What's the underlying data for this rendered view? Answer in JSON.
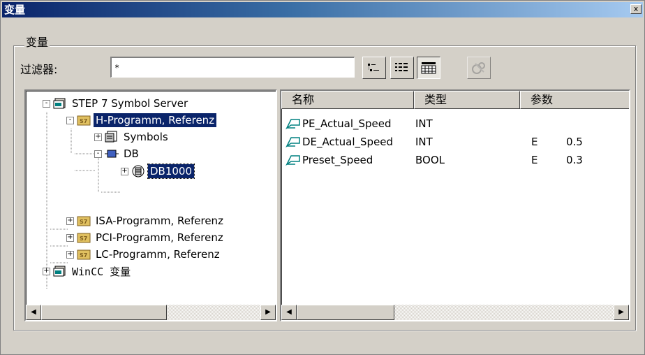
{
  "window": {
    "title": "变量",
    "close_glyph": "x"
  },
  "group": {
    "label": "变量"
  },
  "filter": {
    "label": "过滤器:",
    "value": "*"
  },
  "toolbar": {
    "buttons": [
      {
        "icon": "list-view-icon",
        "pressed": false
      },
      {
        "icon": "details-view-icon",
        "pressed": false
      },
      {
        "icon": "grid-view-icon",
        "pressed": true
      },
      {
        "icon": "properties-icon",
        "disabled": true
      }
    ]
  },
  "tree": {
    "items": [
      {
        "label": "STEP 7 Symbol Server",
        "icon": "server-icon",
        "expander": "-"
      },
      {
        "label": "H-Programm, Referenz",
        "icon": "s7-program-icon",
        "expander": "-",
        "state": "selected"
      },
      {
        "label": "Symbols",
        "icon": "symbols-icon",
        "expander": "+"
      },
      {
        "label": "DB",
        "icon": "db-icon",
        "expander": "-"
      },
      {
        "label": "DB1000",
        "icon": "db-block-icon",
        "expander": "+",
        "state": "focused"
      },
      {
        "label": "ISA-Programm, Referenz",
        "icon": "s7-program-icon",
        "expander": "+"
      },
      {
        "label": "PCI-Programm, Referenz",
        "icon": "s7-program-icon",
        "expander": "+"
      },
      {
        "label": "LC-Programm, Referenz",
        "icon": "s7-program-icon",
        "expander": "+"
      },
      {
        "label": "WinCC 变量",
        "icon": "server-icon",
        "expander": "+"
      }
    ]
  },
  "list": {
    "columns": [
      "名称",
      "类型",
      "参数"
    ],
    "rows": [
      {
        "name": "PE_Actual_Speed",
        "type": "INT",
        "param1": "",
        "param2": ""
      },
      {
        "name": "DE_Actual_Speed",
        "type": "INT",
        "param1": "E",
        "param2": "0.5"
      },
      {
        "name": "Preset_Speed",
        "type": "BOOL",
        "param1": "E",
        "param2": "0.3"
      }
    ]
  },
  "scroll": {
    "left": "◀",
    "right": "▶"
  }
}
